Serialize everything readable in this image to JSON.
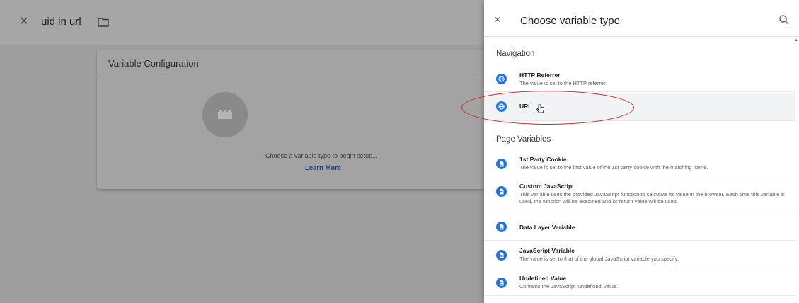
{
  "editor": {
    "close_label": "×",
    "variable_name": "uid in url",
    "folder_icon": "folder-icon"
  },
  "card": {
    "title": "Variable Configuration",
    "prompt": "Choose a variable type to begin setup...",
    "learn_more": "Learn More"
  },
  "drawer": {
    "close_label": "×",
    "title": "Choose variable type",
    "search_icon": "search-icon"
  },
  "sections": [
    {
      "title": "Navigation",
      "items": [
        {
          "name": "HTTP Referrer",
          "desc": "The value is set to the HTTP referrer.",
          "icon": "globe-icon"
        },
        {
          "name": "URL",
          "desc": "",
          "icon": "globe-icon",
          "selected": true
        }
      ]
    },
    {
      "title": "Page Variables",
      "items": [
        {
          "name": "1st Party Cookie",
          "desc": "The value is set to the first value of the 1st party cookie with the matching name.",
          "icon": "document-icon"
        },
        {
          "name": "Custom JavaScript",
          "desc": "This variable uses the provided JavaScript function to calculate its value in the browser. Each time this variable is used, the function will be executed and its return value will be used.",
          "icon": "document-icon"
        },
        {
          "name": "Data Layer Variable",
          "desc": "",
          "icon": "document-icon"
        },
        {
          "name": "JavaScript Variable",
          "desc": "The value is set to that of the global JavaScript variable you specify.",
          "icon": "document-icon"
        },
        {
          "name": "Undefined Value",
          "desc": "Contains the JavaScript 'undefined' value.",
          "icon": "document-icon"
        }
      ]
    }
  ],
  "colors": {
    "accent": "#1a73e8",
    "highlight": "#d92020",
    "overlay": "#9e9e9e"
  }
}
